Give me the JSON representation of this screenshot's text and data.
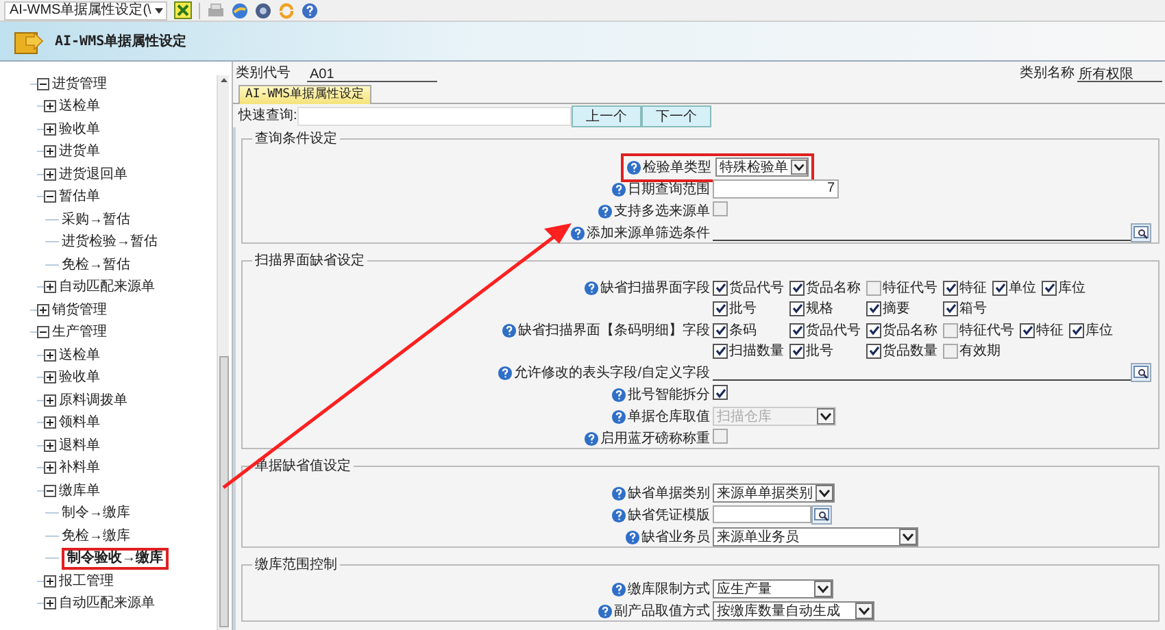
{
  "toolbar": {
    "title_dropdown": "AI-WMS单据属性设定(\\"
  },
  "header": {
    "title": "AI-WMS单据属性设定"
  },
  "tree": {
    "items": [
      {
        "label": "进货管理",
        "expanded": true,
        "selected": false,
        "children": [
          {
            "label": "送检单",
            "expanded": false,
            "selected": false
          },
          {
            "label": "验收单",
            "expanded": false,
            "selected": false
          },
          {
            "label": "进货单",
            "expanded": false,
            "selected": false
          },
          {
            "label": "进货退回单",
            "expanded": false,
            "selected": false
          },
          {
            "label": "暂估单",
            "expanded": true,
            "selected": false,
            "children": [
              {
                "label": "采购→暂估",
                "selected": false
              },
              {
                "label": "进货检验→暂估",
                "selected": false
              },
              {
                "label": "免检→暂估",
                "selected": false
              }
            ]
          },
          {
            "label": "自动匹配来源单",
            "expanded": false,
            "selected": false
          }
        ]
      },
      {
        "label": "销货管理",
        "expanded": false,
        "selected": false
      },
      {
        "label": "生产管理",
        "expanded": true,
        "selected": false,
        "children": [
          {
            "label": "送检单",
            "expanded": false,
            "selected": false
          },
          {
            "label": "验收单",
            "expanded": false,
            "selected": false
          },
          {
            "label": "原料调拨单",
            "expanded": false,
            "selected": false
          },
          {
            "label": "领料单",
            "expanded": false,
            "selected": false
          },
          {
            "label": "退料单",
            "expanded": false,
            "selected": false
          },
          {
            "label": "补料单",
            "expanded": false,
            "selected": false
          },
          {
            "label": "缴库单",
            "expanded": true,
            "selected": false,
            "children": [
              {
                "label": "制令→缴库",
                "selected": false
              },
              {
                "label": "免检→缴库",
                "selected": false
              },
              {
                "label": "制令验收→缴库",
                "selected": true
              }
            ]
          },
          {
            "label": "报工管理",
            "expanded": false,
            "selected": false
          },
          {
            "label": "自动匹配来源单",
            "expanded": false,
            "selected": false
          }
        ]
      }
    ]
  },
  "info": {
    "code_label": "类别代号",
    "code_value": "A01",
    "name_label": "类别名称",
    "name_value": "所有权限"
  },
  "tabs": [
    {
      "label": "AI-WMS单据属性设定",
      "selected": true
    }
  ],
  "quick_search": {
    "label": "快速查询:",
    "prev_button": "上一个",
    "next_button": "下一个"
  },
  "sections": [
    {
      "title": "查询条件设定",
      "fields": [
        {
          "kind": "select",
          "label": "检验单类型",
          "value": "特殊检验单",
          "highlighted": true
        },
        {
          "kind": "text",
          "label": "日期查询范围",
          "value": "7"
        },
        {
          "kind": "checkbox",
          "label": "支持多选来源单",
          "checked": false
        },
        {
          "kind": "lookup",
          "label": "添加来源单筛选条件"
        }
      ]
    },
    {
      "title": "扫描界面缺省设定",
      "fields": [
        {
          "kind": "checkgroup",
          "label": "缺省扫描界面字段",
          "rows": [
            [
              {
                "label": "货品代号",
                "checked": true
              },
              {
                "label": "货品名称",
                "checked": true
              },
              {
                "label": "特征代号",
                "checked": false
              },
              {
                "label": "特征",
                "checked": true
              },
              {
                "label": "单位",
                "checked": true
              },
              {
                "label": "库位",
                "checked": true
              }
            ],
            [
              {
                "label": "批号",
                "checked": true
              },
              {
                "label": "规格",
                "checked": true
              },
              {
                "label": "摘要",
                "checked": true
              },
              {
                "label": "箱号",
                "checked": true
              }
            ]
          ]
        },
        {
          "kind": "checkgroup",
          "label": "缺省扫描界面【条码明细】字段",
          "rows": [
            [
              {
                "label": "条码",
                "checked": true
              },
              {
                "label": "货品代号",
                "checked": true
              },
              {
                "label": "货品名称",
                "checked": true
              },
              {
                "label": "特征代号",
                "checked": false
              },
              {
                "label": "特征",
                "checked": true
              },
              {
                "label": "库位",
                "checked": true
              }
            ],
            [
              {
                "label": "扫描数量",
                "checked": true
              },
              {
                "label": "批号",
                "checked": true
              },
              {
                "label": "货品数量",
                "checked": true
              },
              {
                "label": "有效期",
                "checked": false
              }
            ]
          ]
        },
        {
          "kind": "lookup",
          "label": "允许修改的表头字段/自定义字段"
        },
        {
          "kind": "checkbox",
          "label": "批号智能拆分",
          "checked": true
        },
        {
          "kind": "select",
          "label": "单据仓库取值",
          "value": "扫描仓库",
          "disabled": true
        },
        {
          "kind": "checkbox",
          "label": "启用蓝牙磅称称重",
          "checked": false
        }
      ]
    },
    {
      "title": "单据缺省值设定",
      "fields": [
        {
          "kind": "select",
          "label": "缺省单据类别",
          "value": "来源单单据类别"
        },
        {
          "kind": "lookup_short",
          "label": "缺省凭证模版"
        },
        {
          "kind": "select",
          "label": "缺省业务员",
          "value": "来源单业务员"
        }
      ]
    },
    {
      "title": "缴库范围控制",
      "fields": [
        {
          "kind": "select",
          "label": "缴库限制方式",
          "value": "应生产量"
        },
        {
          "kind": "select",
          "label": "副产品取值方式",
          "value": "按缴库数量自动生成"
        }
      ]
    }
  ]
}
